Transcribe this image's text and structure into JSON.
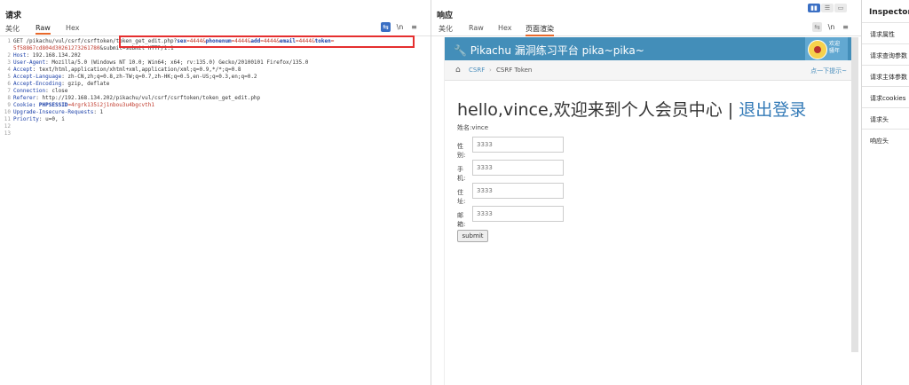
{
  "request": {
    "title": "请求",
    "tabs": [
      "美化",
      "Raw",
      "Hex"
    ],
    "active_tab": "Raw",
    "icons": [
      "wrap-icon",
      "newline-icon",
      "menu-icon"
    ],
    "lines": [
      {
        "n": "1",
        "segs": [
          {
            "t": "GET /pikachu/vul/csrf/csrftoken/token_get_edit.php?",
            "c": "hv"
          },
          {
            "t": "sex",
            "c": "pk"
          },
          {
            "t": "=4444&",
            "c": "pv"
          },
          {
            "t": "phonenum",
            "c": "pk"
          },
          {
            "t": "=4444&",
            "c": "pv"
          },
          {
            "t": "add",
            "c": "pk"
          },
          {
            "t": "=4444&",
            "c": "pv"
          },
          {
            "t": "email",
            "c": "pk"
          },
          {
            "t": "=4444&",
            "c": "pv"
          },
          {
            "t": "token",
            "c": "pk"
          },
          {
            "t": "=",
            "c": "pv"
          }
        ]
      },
      {
        "n": "",
        "segs": [
          {
            "t": "5f58867cd804d30261273261780",
            "c": "pv"
          },
          {
            "t": "&submit=submit HTTP/1.1",
            "c": "hv"
          }
        ]
      },
      {
        "n": "2",
        "segs": [
          {
            "t": "Host",
            "c": "hk"
          },
          {
            "t": ": 192.168.134.202",
            "c": "hv"
          }
        ]
      },
      {
        "n": "3",
        "segs": [
          {
            "t": "User-Agent",
            "c": "hk"
          },
          {
            "t": ": Mozilla/5.0 (Windows NT 10.0; Win64; x64; rv:135.0) Gecko/20100101 Firefox/135.0",
            "c": "hv"
          }
        ]
      },
      {
        "n": "4",
        "segs": [
          {
            "t": "Accept",
            "c": "hk"
          },
          {
            "t": ": text/html,application/xhtml+xml,application/xml;q=0.9,*/*;q=0.8",
            "c": "hv"
          }
        ]
      },
      {
        "n": "5",
        "segs": [
          {
            "t": "Accept-Language",
            "c": "hk"
          },
          {
            "t": ": zh-CN,zh;q=0.8,zh-TW;q=0.7,zh-HK;q=0.5,en-US;q=0.3,en;q=0.2",
            "c": "hv"
          }
        ]
      },
      {
        "n": "6",
        "segs": [
          {
            "t": "Accept-Encoding",
            "c": "hk"
          },
          {
            "t": ": gzip, deflate",
            "c": "hv"
          }
        ]
      },
      {
        "n": "7",
        "segs": [
          {
            "t": "Connection",
            "c": "hk"
          },
          {
            "t": ": close",
            "c": "hv"
          }
        ]
      },
      {
        "n": "8",
        "segs": [
          {
            "t": "Referer",
            "c": "hk"
          },
          {
            "t": ": http://192.168.134.202/pikachu/vul/csrf/csrftoken/token_get_edit.php",
            "c": "hv"
          }
        ]
      },
      {
        "n": "9",
        "segs": [
          {
            "t": "Cookie",
            "c": "hk"
          },
          {
            "t": ": PHPSESSID",
            "c": "pk"
          },
          {
            "t": "=4rgrk135i2j1nbou3u4bgcvth1",
            "c": "pv"
          }
        ]
      },
      {
        "n": "10",
        "segs": [
          {
            "t": "Upgrade-Insecure-Requests",
            "c": "hk"
          },
          {
            "t": ": 1",
            "c": "hv"
          }
        ]
      },
      {
        "n": "11",
        "segs": [
          {
            "t": "Priority",
            "c": "hk"
          },
          {
            "t": ": u=0, i",
            "c": "hv"
          }
        ]
      },
      {
        "n": "12",
        "segs": []
      },
      {
        "n": "13",
        "segs": []
      }
    ]
  },
  "response": {
    "title": "响应",
    "tabs": [
      "美化",
      "Raw",
      "Hex",
      "页面渲染"
    ],
    "active_tab": "页面渲染",
    "render": {
      "brand": "Pikachu 漏洞练习平台 pika~pika~",
      "welcome": "欢迎\n骚年",
      "breadcrumb": [
        "CSRF",
        "CSRF Token"
      ],
      "hint": "点一下提示~",
      "hello": "hello,vince,欢迎来到个人会员中心 | ",
      "logout": "退出登录",
      "username_label": "姓名:vince",
      "fields": [
        {
          "label": "性别:",
          "placeholder": "3333"
        },
        {
          "label": "手机:",
          "placeholder": "3333"
        },
        {
          "label": "住址:",
          "placeholder": "3333"
        },
        {
          "label": "邮箱:",
          "placeholder": "3333"
        }
      ],
      "submit": "submit"
    },
    "nav_color": "#438eb9"
  },
  "inspector": {
    "title": "Inspector",
    "sections": [
      "请求属性",
      "请求查询参数",
      "请求主体参数",
      "请求cookies",
      "请求头",
      "响应头"
    ]
  }
}
